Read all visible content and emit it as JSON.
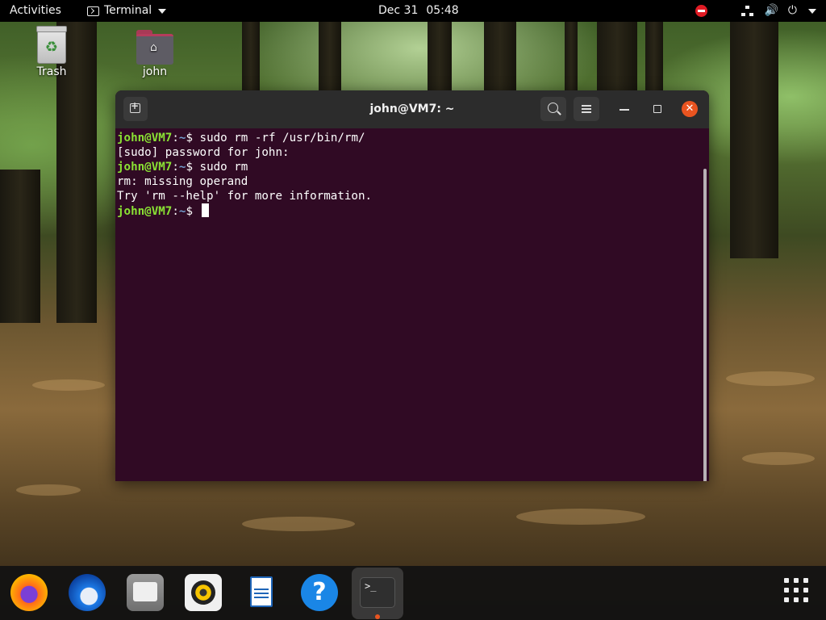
{
  "topbar": {
    "activities": "Activities",
    "app_menu": "Terminal",
    "clock_date": "Dec 31",
    "clock_time": "05:48"
  },
  "desktop": {
    "icons": [
      {
        "label": "Trash",
        "icon": "trash-icon"
      },
      {
        "label": "john",
        "icon": "home-folder-icon"
      }
    ]
  },
  "terminal": {
    "title": "john@VM7: ~",
    "prompt_user": "john@VM7",
    "prompt_sep": ":",
    "prompt_path": "~",
    "prompt_sym": "$ ",
    "lines": [
      {
        "type": "prompt",
        "cmd": "sudo rm -rf /usr/bin/rm/"
      },
      {
        "type": "output",
        "text": "[sudo] password for john:"
      },
      {
        "type": "prompt",
        "cmd": "sudo rm"
      },
      {
        "type": "output",
        "text": "rm: missing operand"
      },
      {
        "type": "output",
        "text": "Try 'rm --help' for more information."
      },
      {
        "type": "prompt",
        "cmd": ""
      }
    ],
    "colors": {
      "background": "#300a24",
      "user": "#8ae234",
      "path": "#729fcf"
    }
  },
  "dock": {
    "items": [
      {
        "name": "firefox-icon"
      },
      {
        "name": "thunderbird-icon"
      },
      {
        "name": "files-icon"
      },
      {
        "name": "rhythmbox-icon"
      },
      {
        "name": "libreoffice-writer-icon"
      },
      {
        "name": "help-icon",
        "glyph": "?"
      },
      {
        "name": "terminal-icon",
        "glyph": ">_",
        "running": true
      }
    ]
  },
  "tray": {
    "icons": [
      "notification-red-icon",
      "network-icon",
      "volume-icon",
      "power-icon",
      "chevron-down-icon"
    ]
  }
}
